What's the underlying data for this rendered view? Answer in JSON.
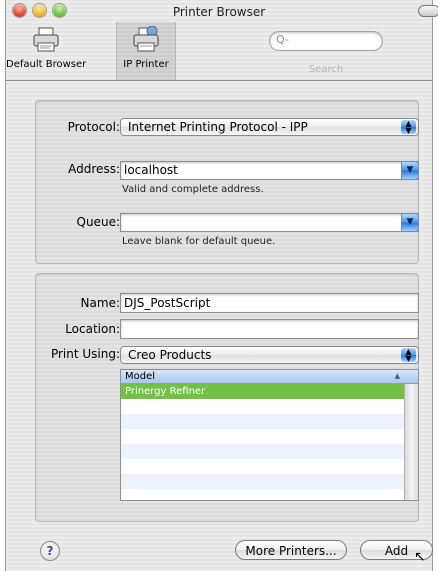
{
  "window": {
    "title": "Printer Browser"
  },
  "toolbar": {
    "default_browser": "Default Browser",
    "ip_printer": "IP Printer",
    "search_placeholder": "Q-",
    "search_label": "Search"
  },
  "ip": {
    "protocol_label": "Protocol:",
    "protocol_value": "Internet Printing Protocol - IPP",
    "address_label": "Address:",
    "address_value": "localhost",
    "address_hint": "Valid and complete address.",
    "queue_label": "Queue:",
    "queue_value": "",
    "queue_hint": "Leave blank for default queue."
  },
  "printer": {
    "name_label": "Name:",
    "name_value": "DJS_PostScript",
    "location_label": "Location:",
    "location_value": "",
    "print_using_label": "Print Using:",
    "print_using_value": "Creo Products",
    "model_header": "Model",
    "models": [
      "Prinergy Refiner",
      "",
      "",
      "",
      "",
      "",
      "",
      ""
    ]
  },
  "buttons": {
    "help": "?",
    "more_printers": "More Printers...",
    "add": "Add"
  },
  "colors": {
    "selection": "#72c144",
    "aqua": "#4a95ea"
  }
}
